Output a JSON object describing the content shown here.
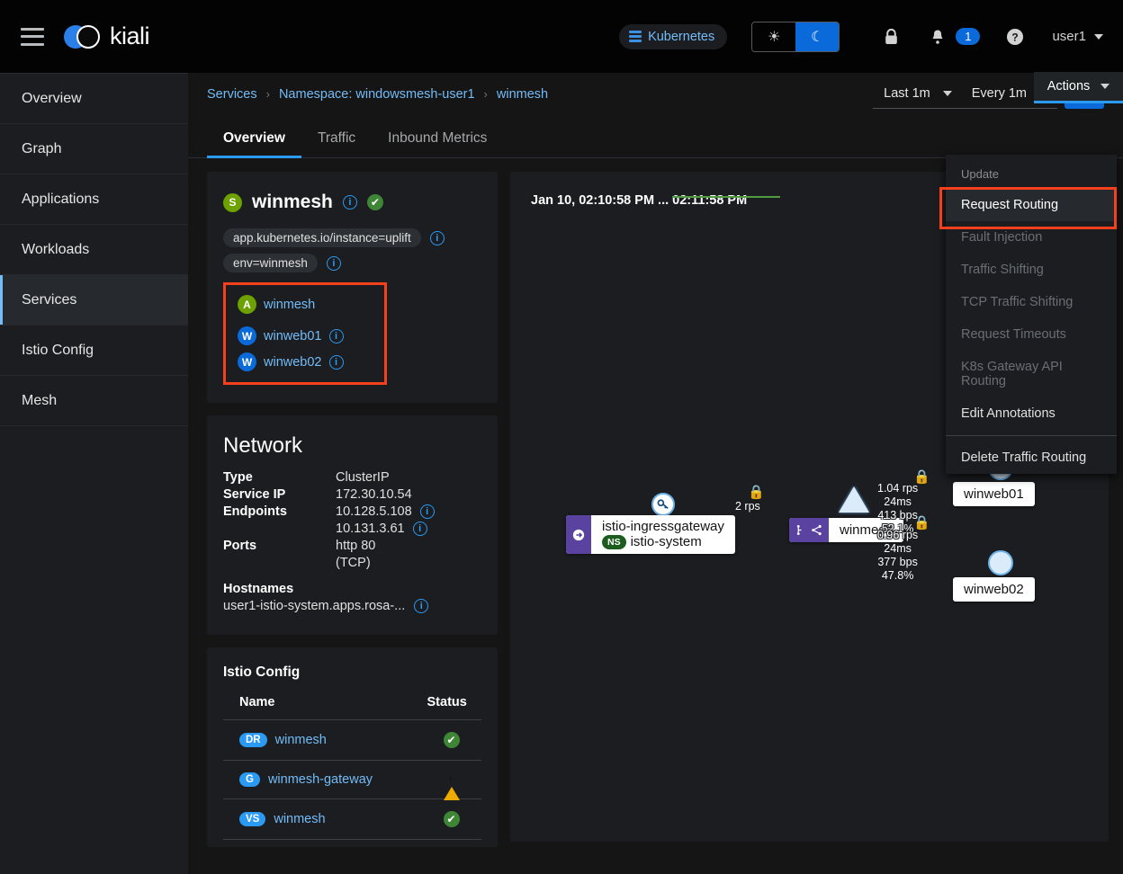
{
  "masthead": {
    "logo_text": "kiali",
    "cluster_pill": "Kubernetes",
    "theme_light_icon": "☀",
    "theme_dark_icon": "☾",
    "lock_icon": "🔒",
    "bell_icon": "🔔",
    "notification_count": "1",
    "help_icon": "?",
    "user_name": "user1"
  },
  "sidebar": {
    "items": [
      {
        "label": "Overview",
        "active": false
      },
      {
        "label": "Graph",
        "active": false
      },
      {
        "label": "Applications",
        "active": false
      },
      {
        "label": "Workloads",
        "active": false
      },
      {
        "label": "Services",
        "active": true
      },
      {
        "label": "Istio Config",
        "active": false
      },
      {
        "label": "Mesh",
        "active": false
      }
    ]
  },
  "breadcrumb": {
    "root": "Services",
    "namespace": "Namespace: windowsmesh-user1",
    "current": "winmesh",
    "separator": "›"
  },
  "time_controls": {
    "range": "Last 1m",
    "interval": "Every 1m",
    "refresh_icon": "↻"
  },
  "tabs": [
    {
      "label": "Overview",
      "active": true
    },
    {
      "label": "Traffic",
      "active": false
    },
    {
      "label": "Inbound Metrics",
      "active": false
    }
  ],
  "actions": {
    "button_label": "Actions",
    "section_label": "Update",
    "items": [
      {
        "label": "Request Routing",
        "state": "selected"
      },
      {
        "label": "Fault Injection",
        "state": "disabled"
      },
      {
        "label": "Traffic Shifting",
        "state": "disabled"
      },
      {
        "label": "TCP Traffic Shifting",
        "state": "disabled"
      },
      {
        "label": "Request Timeouts",
        "state": "disabled"
      },
      {
        "label": "K8s Gateway API Routing",
        "state": "disabled"
      },
      {
        "label": "Edit Annotations",
        "state": "normal"
      }
    ],
    "delete_label": "Delete Traffic Routing",
    "highlight_color": "#f4401c"
  },
  "service_card": {
    "type_badge": "S",
    "name": "winmesh",
    "health_icon": "✔",
    "labels": [
      {
        "text": "app.kubernetes.io/instance=uplift"
      },
      {
        "text": "env=winmesh"
      }
    ],
    "related": [
      {
        "badge": "A",
        "badge_color": "green",
        "name": "winmesh",
        "has_info": false
      },
      {
        "badge": "W",
        "badge_color": "blue",
        "name": "winweb01",
        "has_info": true
      },
      {
        "badge": "W",
        "badge_color": "blue",
        "name": "winweb02",
        "has_info": true
      }
    ]
  },
  "network_card": {
    "title": "Network",
    "type_key": "Type",
    "type_value": "ClusterIP",
    "service_ip_key": "Service IP",
    "service_ip_value": "172.30.10.54",
    "endpoints_key": "Endpoints",
    "endpoints": [
      "10.128.5.108",
      "10.131.3.61"
    ],
    "ports_key": "Ports",
    "ports_value_line1": "http 80",
    "ports_value_line2": "(TCP)",
    "hostnames_key": "Hostnames",
    "hostname_value": "user1-istio-system.apps.rosa-..."
  },
  "istio_config_card": {
    "title": "Istio Config",
    "col_name": "Name",
    "col_status": "Status",
    "rows": [
      {
        "badge": "DR",
        "name": "winmesh",
        "status": "ok"
      },
      {
        "badge": "G",
        "name": "winmesh-gateway",
        "status": "warning"
      },
      {
        "badge": "VS",
        "name": "winmesh",
        "status": "ok"
      }
    ]
  },
  "graph": {
    "time_label": "Jan 10, 02:10:58 PM ... 02:11:58 PM",
    "nodes": [
      {
        "id": "ingressgateway",
        "label": "istio-ingressgateway",
        "sublabel": "istio-system",
        "ns_badge": "NS",
        "shape": "key"
      },
      {
        "id": "winmesh",
        "label": "winmesh",
        "shape": "triangle"
      },
      {
        "id": "winweb01",
        "label": "winweb01",
        "shape": "circle"
      },
      {
        "id": "winweb02",
        "label": "winweb02",
        "shape": "circle"
      }
    ],
    "edges": [
      {
        "from": "ingressgateway",
        "to": "winmesh",
        "label": "2 rps",
        "secured": true
      },
      {
        "from": "winmesh",
        "to": "winweb01",
        "rps": "1.04 rps",
        "latency": "24ms",
        "throughput": "413 bps",
        "percent": "52.1%",
        "secured": true
      },
      {
        "from": "winmesh",
        "to": "winweb02",
        "rps": "0.96 rps",
        "latency": "24ms",
        "throughput": "377 bps",
        "percent": "47.8%",
        "secured": true
      }
    ],
    "edge_color": "#4f9b41",
    "lock_glyph": "🔒"
  }
}
